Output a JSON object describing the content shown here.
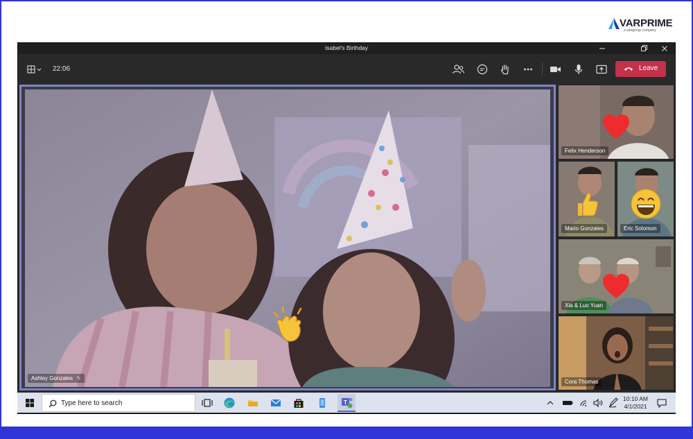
{
  "brand": {
    "name": "VARPRIME",
    "tagline": "a sangroup company"
  },
  "window": {
    "title": "Isabel's Birthday"
  },
  "toolbar": {
    "elapsed": "22:06",
    "leave_label": "Leave",
    "icons": [
      "view-layout-icon",
      "people-icon",
      "chat-icon",
      "raise-hand-icon",
      "more-options-icon",
      "camera-icon",
      "microphone-icon",
      "share-screen-icon",
      "hang-up-icon"
    ]
  },
  "participants": {
    "main": "Ashley Gonzales",
    "tile1": "Felix Henderson",
    "tile2": "Mario Gonzales",
    "tile3": "Eric Solomon",
    "tile4": "Xia & Luo Yuan",
    "tile5": "Cora Thomas"
  },
  "reactions": [
    "clap",
    "heart",
    "like",
    "laugh",
    "heart"
  ],
  "taskbar": {
    "search_placeholder": "Type here to search",
    "time": "10:10 AM",
    "date": "4/1/2021"
  },
  "colors": {
    "leave": "#c4314b",
    "stage_border": "#7f85c5",
    "frame": "#2f35d8"
  }
}
